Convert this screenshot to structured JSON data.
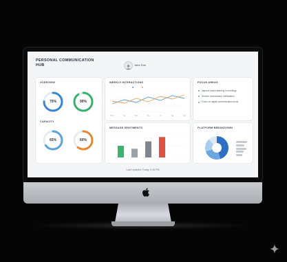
{
  "header": {
    "app_title": "PERSONAL COMMUNICATION HUB",
    "user_name": "Jane Doe"
  },
  "overview": {
    "title": "OVERVIEW",
    "metrics": [
      {
        "value": "75%",
        "fraction": 0.75,
        "color": "#3b82d6"
      },
      {
        "value": "90%",
        "fraction": 0.9,
        "color": "#34b36a"
      }
    ]
  },
  "capacity": {
    "title": "CAPACITY",
    "metrics": [
      {
        "value": "65%",
        "fraction": 0.65,
        "color": "#5aa2d8"
      },
      {
        "value": "60%",
        "fraction": 0.6,
        "color": "#e8862c"
      }
    ]
  },
  "weekly": {
    "title": "WEEKLY INTERACTIONS",
    "chart_data": {
      "type": "line",
      "categories": [
        "Mon",
        "Tue",
        "Wed",
        "Thu",
        "Fri",
        "Sat",
        "Sun"
      ],
      "series": [
        {
          "values": [
            12,
            18,
            14,
            22,
            17,
            24,
            20
          ],
          "color": "#5b9bd5"
        },
        {
          "values": [
            16,
            13,
            20,
            15,
            23,
            19,
            25
          ],
          "color": "#f0a45c"
        }
      ],
      "ylim": [
        0,
        30
      ]
    }
  },
  "focus": {
    "title": "FOCUS AREAS",
    "items": [
      "Improve active listening in meetings",
      "Reduce unnecessary notifications",
      "Focus on digital communication focus"
    ]
  },
  "sentiment": {
    "title": "MESSAGE SENTIMENTS",
    "chart_data": {
      "type": "bar",
      "values": [
        40,
        30,
        55,
        70
      ],
      "colors": [
        "#3cb371",
        "#9aa1a8",
        "#7f868d",
        "#e2513c"
      ],
      "ylim": [
        0,
        80
      ]
    }
  },
  "platform": {
    "title": "PLATFORM BREAKDOWN",
    "chart_data": {
      "type": "pie",
      "values": [
        45,
        25,
        18,
        12
      ],
      "colors": [
        "#2f6fc2",
        "#6aa6e0",
        "#a9cdef",
        "#dbe9f7"
      ]
    }
  },
  "footer": {
    "status": "Last Updated: Today, 9:15 PM"
  }
}
